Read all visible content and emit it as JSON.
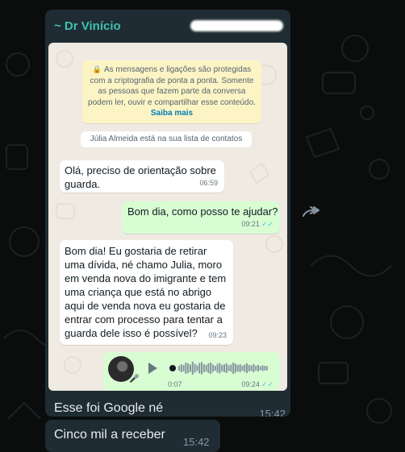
{
  "forwarded": {
    "sender_name": "~ Dr Vinício",
    "caption": "Esse foi Google né",
    "caption_time": "15:42"
  },
  "screenshot": {
    "encryption_notice": "As mensagens e ligações são protegidas com a criptografia de ponta a ponta. Somente as pessoas que fazem parte da conversa podem ler, ouvir e compartilhar esse conteúdo.",
    "encryption_more": "Saiba mais",
    "contact_notice": "Júlia Almeida está na sua lista de contatos",
    "messages": [
      {
        "direction": "in",
        "text": "Olá, preciso de orientação sobre guarda.",
        "time": "06:59"
      },
      {
        "direction": "out",
        "text": "Bom dia, como posso te ajudar?",
        "time": "09:21",
        "ticks": "✓✓"
      },
      {
        "direction": "in",
        "text": "Bom dia! Eu gostaria de retirar uma dívida, né chamo Julia, moro em venda nova do imigrante e tem uma criança que está no abrigo aqui de venda nova eu gostaria de entrar com processo para tentar a guarda dele isso é possível?",
        "time": "09:23"
      }
    ],
    "voice_note": {
      "duration": "0:07",
      "time": "09:24",
      "ticks": "✓✓",
      "progress": 0
    }
  },
  "next_message": {
    "text": "Cinco mil a receber",
    "time": "15:42"
  },
  "icons": {
    "forward": "forward-icon",
    "lock": "lock-icon",
    "play": "play-icon",
    "mic": "mic-icon"
  },
  "colors": {
    "sender": "#3fc1b0",
    "bubble_dark": "#1f2c33",
    "bubble_out": "#d9fdd3",
    "read_ticks": "#53bdeb"
  }
}
